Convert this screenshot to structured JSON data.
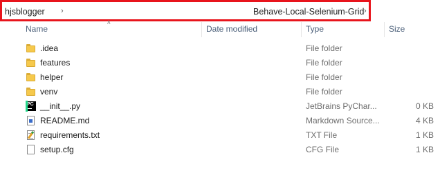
{
  "breadcrumb": {
    "items": [
      "hjsblogger",
      "Behave-Local-Selenium-Grid"
    ]
  },
  "columns": {
    "name": "Name",
    "date_modified": "Date modified",
    "type": "Type",
    "size": "Size"
  },
  "files": [
    {
      "name": ".idea",
      "date": "",
      "type": "File folder",
      "size": "",
      "icon": "folder-icon"
    },
    {
      "name": "features",
      "date": "",
      "type": "File folder",
      "size": "",
      "icon": "folder-icon"
    },
    {
      "name": "helper",
      "date": "",
      "type": "File folder",
      "size": "",
      "icon": "folder-icon"
    },
    {
      "name": "venv",
      "date": "",
      "type": "File folder",
      "size": "",
      "icon": "folder-icon"
    },
    {
      "name": "__init__.py",
      "date": "",
      "type": "JetBrains PyChar...",
      "size": "0 KB",
      "icon": "pycharm-file-icon"
    },
    {
      "name": "README.md",
      "date": "",
      "type": "Markdown Source...",
      "size": "4 KB",
      "icon": "markdown-file-icon"
    },
    {
      "name": "requirements.txt",
      "date": "",
      "type": "TXT File",
      "size": "1 KB",
      "icon": "text-file-icon"
    },
    {
      "name": "setup.cfg",
      "date": "",
      "type": "CFG File",
      "size": "1 KB",
      "icon": "config-file-icon"
    }
  ],
  "colors": {
    "highlight_border": "#e8141c",
    "folder": "#f6c94c",
    "header_text": "#4c607a",
    "secondary_text": "#6d6d6d"
  }
}
